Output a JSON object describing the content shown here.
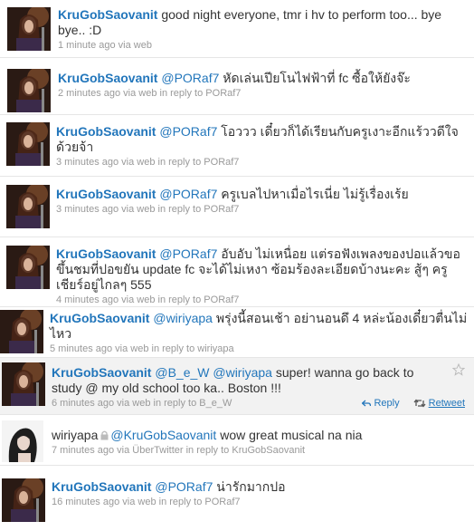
{
  "tweets": [
    {
      "user": "KruGobSaovanit",
      "mention": "",
      "text": " good night everyone, tmr i hv to perform too... bye bye.. :D",
      "time": "1 minute ago",
      "via": "via web",
      "reply_prefix": "",
      "reply_to": "",
      "avatar_icon": "concert-avatar-icon"
    },
    {
      "user": "KruGobSaovanit",
      "mention": "@PORaf7",
      "text": " หัดเล่นเปียโนไฟฟ้าที่ fc ซื้อให้ยังจ๊ะ",
      "time": "2 minutes ago",
      "via": "via web",
      "reply_prefix": "in reply to",
      "reply_to": "PORaf7",
      "avatar_icon": "concert-avatar-icon"
    },
    {
      "user": "KruGobSaovanit",
      "mention": "@PORaf7",
      "text": " โอววว เดี๋ยวก็ได้เรียนกับครูเงาะอีกแร้ววดีใจด้วยจ้า",
      "time": "3 minutes ago",
      "via": "via web",
      "reply_prefix": "in reply to",
      "reply_to": "PORaf7",
      "avatar_icon": "concert-avatar-icon"
    },
    {
      "user": "KruGobSaovanit",
      "mention": "@PORaf7",
      "text": " ครูเบลไปหาเมื่อไรเนี่ย ไม่รู้เรื่องเร้ย",
      "time": "3 minutes ago",
      "via": "via web",
      "reply_prefix": "in reply to",
      "reply_to": "PORaf7",
      "avatar_icon": "concert-avatar-icon"
    },
    {
      "user": "KruGobSaovanit",
      "mention": "@PORaf7",
      "text": " อับอับ ไม่เหนื่อย แต่รอฟังเพลงของปอแล้วขอขึ้นชมที่ปอขยัน update fc จะได้ไม่เหงา ซ้อมร้องละเอียดบ้างนะคะ สู้ๆ ครูเชียร์อยู่ไกลๆ 555",
      "time": "4 minutes ago",
      "via": "via web",
      "reply_prefix": "in reply to",
      "reply_to": "PORaf7",
      "avatar_icon": "concert-avatar-icon"
    },
    {
      "user": "KruGobSaovanit",
      "mention": "@wiriyapa",
      "text": " พรุ่งนี้สอนเช้า อย่านอนดึ 4 หล่ะน้องเดี๋ยวตื่นไม่ไหว",
      "time": "5 minutes ago",
      "via": "via web",
      "reply_prefix": "in reply to",
      "reply_to": "wiriyapa",
      "avatar_icon": "concert-avatar-icon"
    },
    {
      "user": "KruGobSaovanit",
      "mention": "@B_e_W @wiriyapa",
      "text": " super! wanna go back to study @ my old school too ka.. Boston !!!",
      "time": "6 minutes ago",
      "via": "via web",
      "reply_prefix": "in reply to",
      "reply_to": "B_e_W",
      "avatar_icon": "concert-avatar-icon",
      "highlight": true,
      "reply_label": "Reply",
      "retweet_label": "Retweet"
    },
    {
      "user": "wiriyapa",
      "mention": "@KruGobSaovanit",
      "text": " wow great musical na nia",
      "time": "7 minutes ago",
      "via": "via ÜberTwitter",
      "reply_prefix": "in reply to",
      "reply_to": "KruGobSaovanit",
      "avatar_icon": "portrait-avatar-icon",
      "locked": true
    },
    {
      "user": "KruGobSaovanit",
      "mention": "@PORaf7",
      "text": " น่ารักมากปอ",
      "time": "16 minutes ago",
      "via": "via web",
      "reply_prefix": "in reply to",
      "reply_to": "PORaf7",
      "avatar_icon": "concert-avatar-icon"
    }
  ]
}
